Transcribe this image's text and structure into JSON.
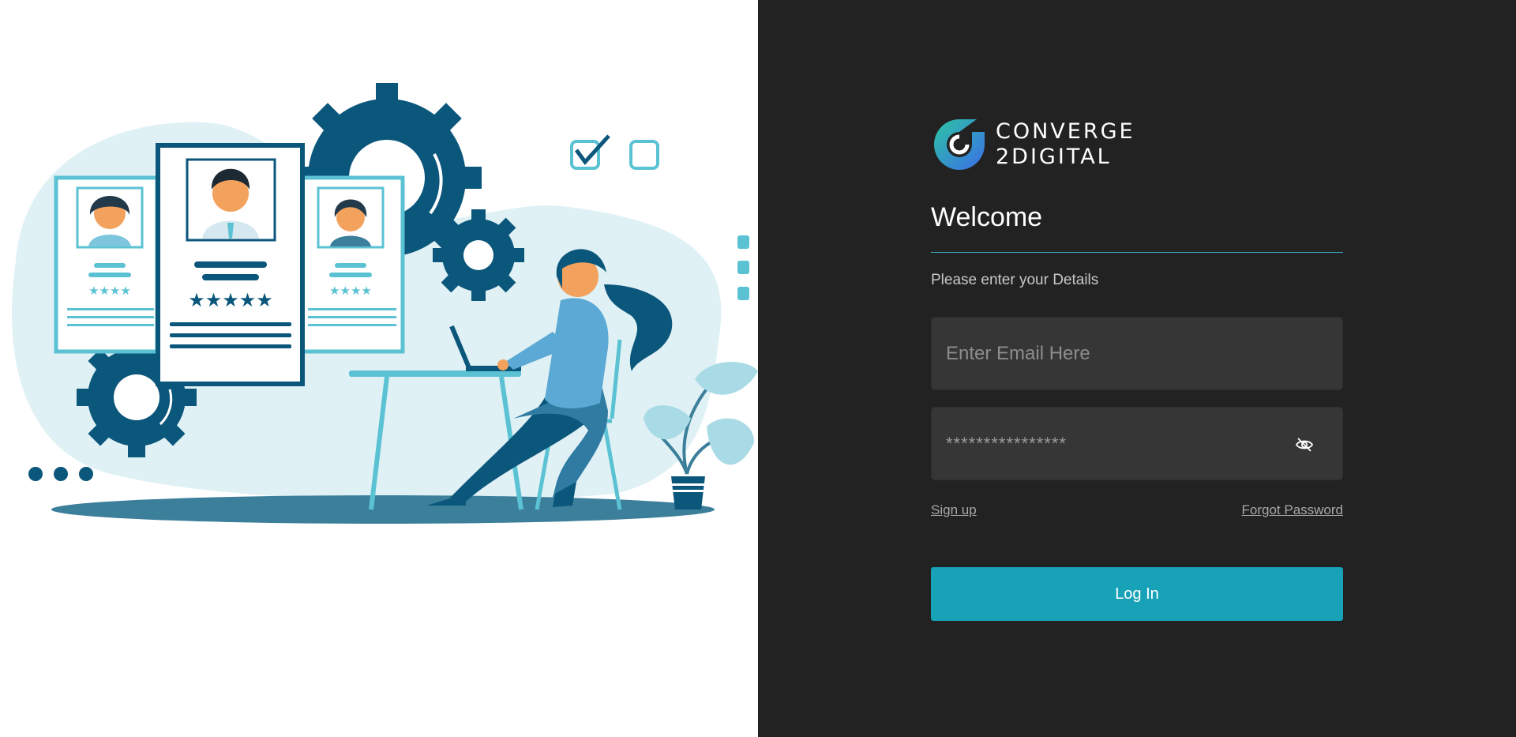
{
  "brand": {
    "name_line1": "CONVERGE",
    "name_line2": "2DIGITAL",
    "colors": {
      "gradient_start": "#2ec4a3",
      "gradient_end": "#3a6ee8"
    }
  },
  "illustration": {
    "subject": "recruiter-at-laptop-with-candidate-cards",
    "colors": {
      "dark": "#0b567b",
      "light": "#dff1f5",
      "accent": "#5bc2d4",
      "ground": "#3c7f9a"
    }
  },
  "form": {
    "title": "Welcome",
    "subtitle": "Please enter your Details",
    "email": {
      "placeholder": "Enter Email Here",
      "value": ""
    },
    "password": {
      "placeholder": "****************",
      "value": ""
    },
    "toggle_icon": "eye-off-icon",
    "signup_label": "Sign up",
    "forgot_label": "Forgot Password",
    "login_label": "Log In"
  },
  "theme": {
    "panel_bg": "#222222",
    "input_bg": "#363636",
    "accent": "#17a2b8",
    "divider": "#3aa7c0"
  }
}
